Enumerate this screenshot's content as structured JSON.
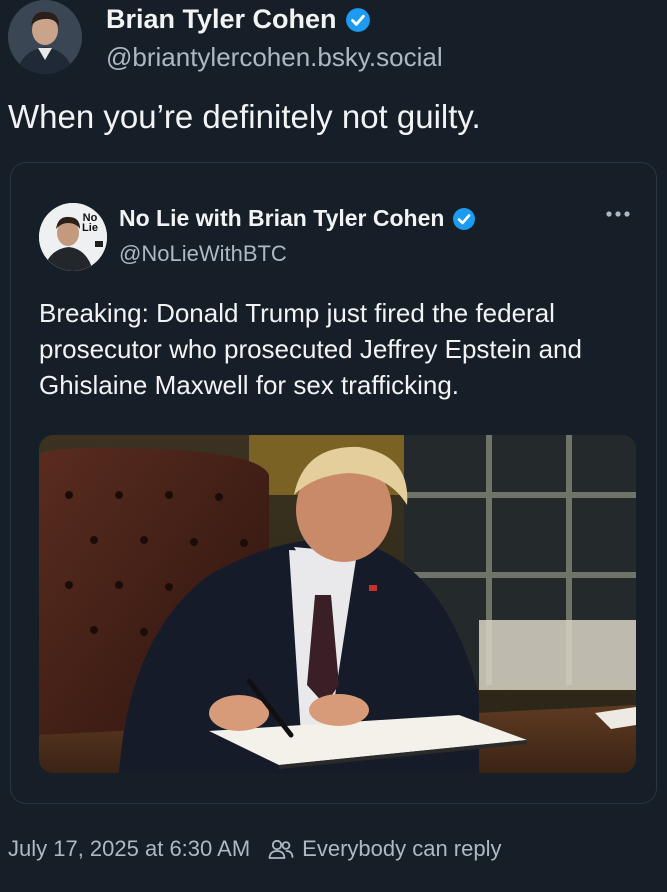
{
  "author": {
    "name": "Brian Tyler Cohen",
    "handle": "@briantylercohen.bsky.social",
    "avatar_icon": "profile-photo"
  },
  "post": {
    "text": "When you’re definitely not guilty."
  },
  "quoted": {
    "name": "No Lie with Brian Tyler Cohen",
    "handle": "@NoLieWithBTC",
    "avatar_logo_text": "No Lie",
    "text": "Breaking: Donald Trump just fired the federal prosecutor who prosecuted Jeffrey Epstein and Ghislaine Maxwell for sex trafficking.",
    "media_icon": "photo-man-signing-document-at-desk"
  },
  "footer": {
    "timestamp": "July 17, 2025 at 6:30 AM",
    "reply_setting": "Everybody can reply"
  },
  "colors": {
    "background": "#161e27",
    "verified": "#1d9bf0",
    "muted_text": "#aeb8c4"
  }
}
